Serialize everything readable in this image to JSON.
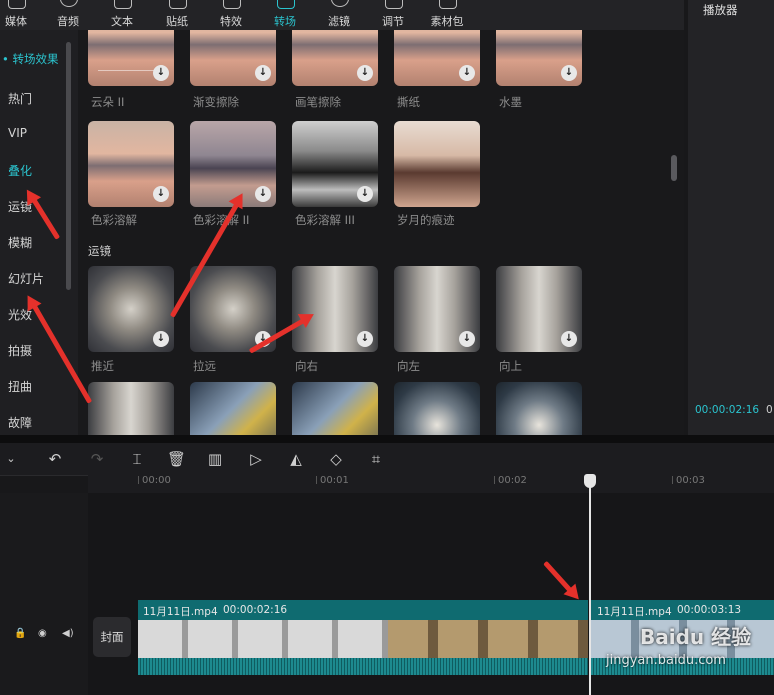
{
  "top_tools": [
    {
      "label": "媒体",
      "icon": "media-icon"
    },
    {
      "label": "音频",
      "icon": "audio-icon"
    },
    {
      "label": "文本",
      "icon": "text-icon"
    },
    {
      "label": "贴纸",
      "icon": "sticker-icon"
    },
    {
      "label": "特效",
      "icon": "effects-icon"
    },
    {
      "label": "转场",
      "icon": "transition-icon",
      "active": true
    },
    {
      "label": "滤镜",
      "icon": "filter-icon"
    },
    {
      "label": "调节",
      "icon": "adjust-icon"
    },
    {
      "label": "素材包",
      "icon": "package-icon"
    }
  ],
  "sidebar": {
    "header": "• 转场效果",
    "items": [
      "热门",
      "VIP",
      "叠化",
      "运镜",
      "模糊",
      "幻灯片",
      "光效",
      "拍摄",
      "扭曲",
      "故障"
    ],
    "selected": "叠化"
  },
  "transitions_row1": [
    "云朵 II",
    "渐变擦除",
    "画笔擦除",
    "撕纸",
    "水墨"
  ],
  "transitions_row2": [
    "色彩溶解",
    "色彩溶解 II",
    "色彩溶解 III",
    "岁月的痕迹"
  ],
  "section_camera": "运镜",
  "transitions_row3": [
    "推近",
    "拉远",
    "向右",
    "向左",
    "向上"
  ],
  "player": {
    "title": "播放器",
    "time": "00:00:02:16",
    "time_cut": "0"
  },
  "ruler": [
    "00:00",
    "00:01",
    "00:02",
    "00:03"
  ],
  "cover_label": "封面",
  "clips": [
    {
      "name": "11月11日.mp4",
      "duration": "00:00:02:16"
    },
    {
      "name": "11月11日.mp4",
      "duration": "00:00:03:13"
    }
  ],
  "watermark": {
    "brand": "Baidu 经验",
    "url": "jingyan.baidu.com"
  },
  "colors": {
    "accent": "#2bc4cf",
    "arrow": "#e4312b",
    "clip": "#0f6b70"
  }
}
